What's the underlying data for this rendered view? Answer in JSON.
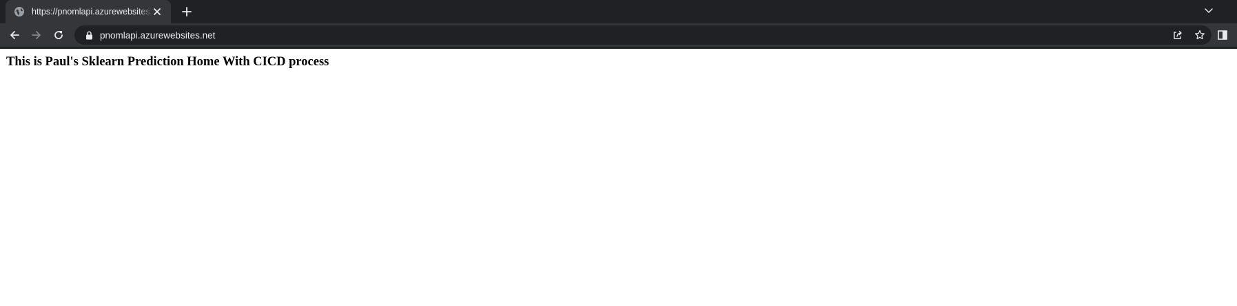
{
  "browser": {
    "tab": {
      "title": "https://pnomlapi.azurewebsites.net/",
      "favicon": "globe-icon"
    },
    "address_bar": {
      "url": "pnomlapi.azurewebsites.net",
      "security_icon": "lock-icon"
    },
    "colors": {
      "frame": "#202124",
      "toolbar": "#35363a",
      "text": "#e8eaed"
    }
  },
  "page": {
    "heading": "This is Paul's Sklearn Prediction Home With CICD process"
  }
}
